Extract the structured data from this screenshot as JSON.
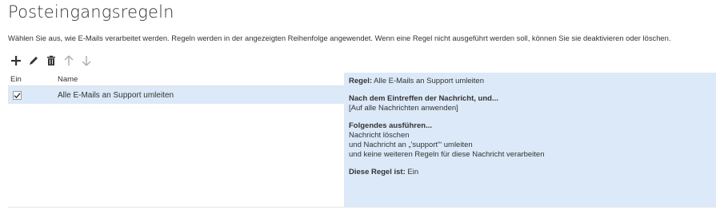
{
  "page": {
    "title": "Posteingangsregeln",
    "description": "Wählen Sie aus, wie E-Mails verarbeitet werden. Regeln werden in der angezeigten Reihenfolge angewendet. Wenn eine Regel nicht ausgeführt werden soll, können Sie sie deaktivieren oder löschen."
  },
  "toolbar": {
    "icons": [
      "add-icon",
      "edit-pencil-icon",
      "delete-trash-icon",
      "move-up-arrow-icon",
      "move-down-arrow-icon"
    ],
    "disabled_color": "#b0b0b0",
    "enabled_color": "#333333"
  },
  "table": {
    "columns": [
      "Ein",
      "Name"
    ],
    "rows": [
      {
        "enabled": true,
        "name": "Alle E-Mails an Support umleiten"
      }
    ],
    "selected_row_color": "#dbe9f8"
  },
  "details": {
    "rule_label": "Regel:",
    "rule_name": " Alle E-Mails an Support umleiten",
    "condition_heading": "Nach dem Eintreffen der Nachricht, und...",
    "condition_text": "[Auf alle Nachrichten anwenden]",
    "actions_heading": "Folgendes ausführen...",
    "actions": [
      "Nachricht löschen",
      "und Nachricht an „'support'“ umleiten",
      "und keine weiteren Regeln für diese Nachricht verarbeiten"
    ],
    "status_label": "Diese Regel ist:",
    "status_value": " Ein"
  }
}
